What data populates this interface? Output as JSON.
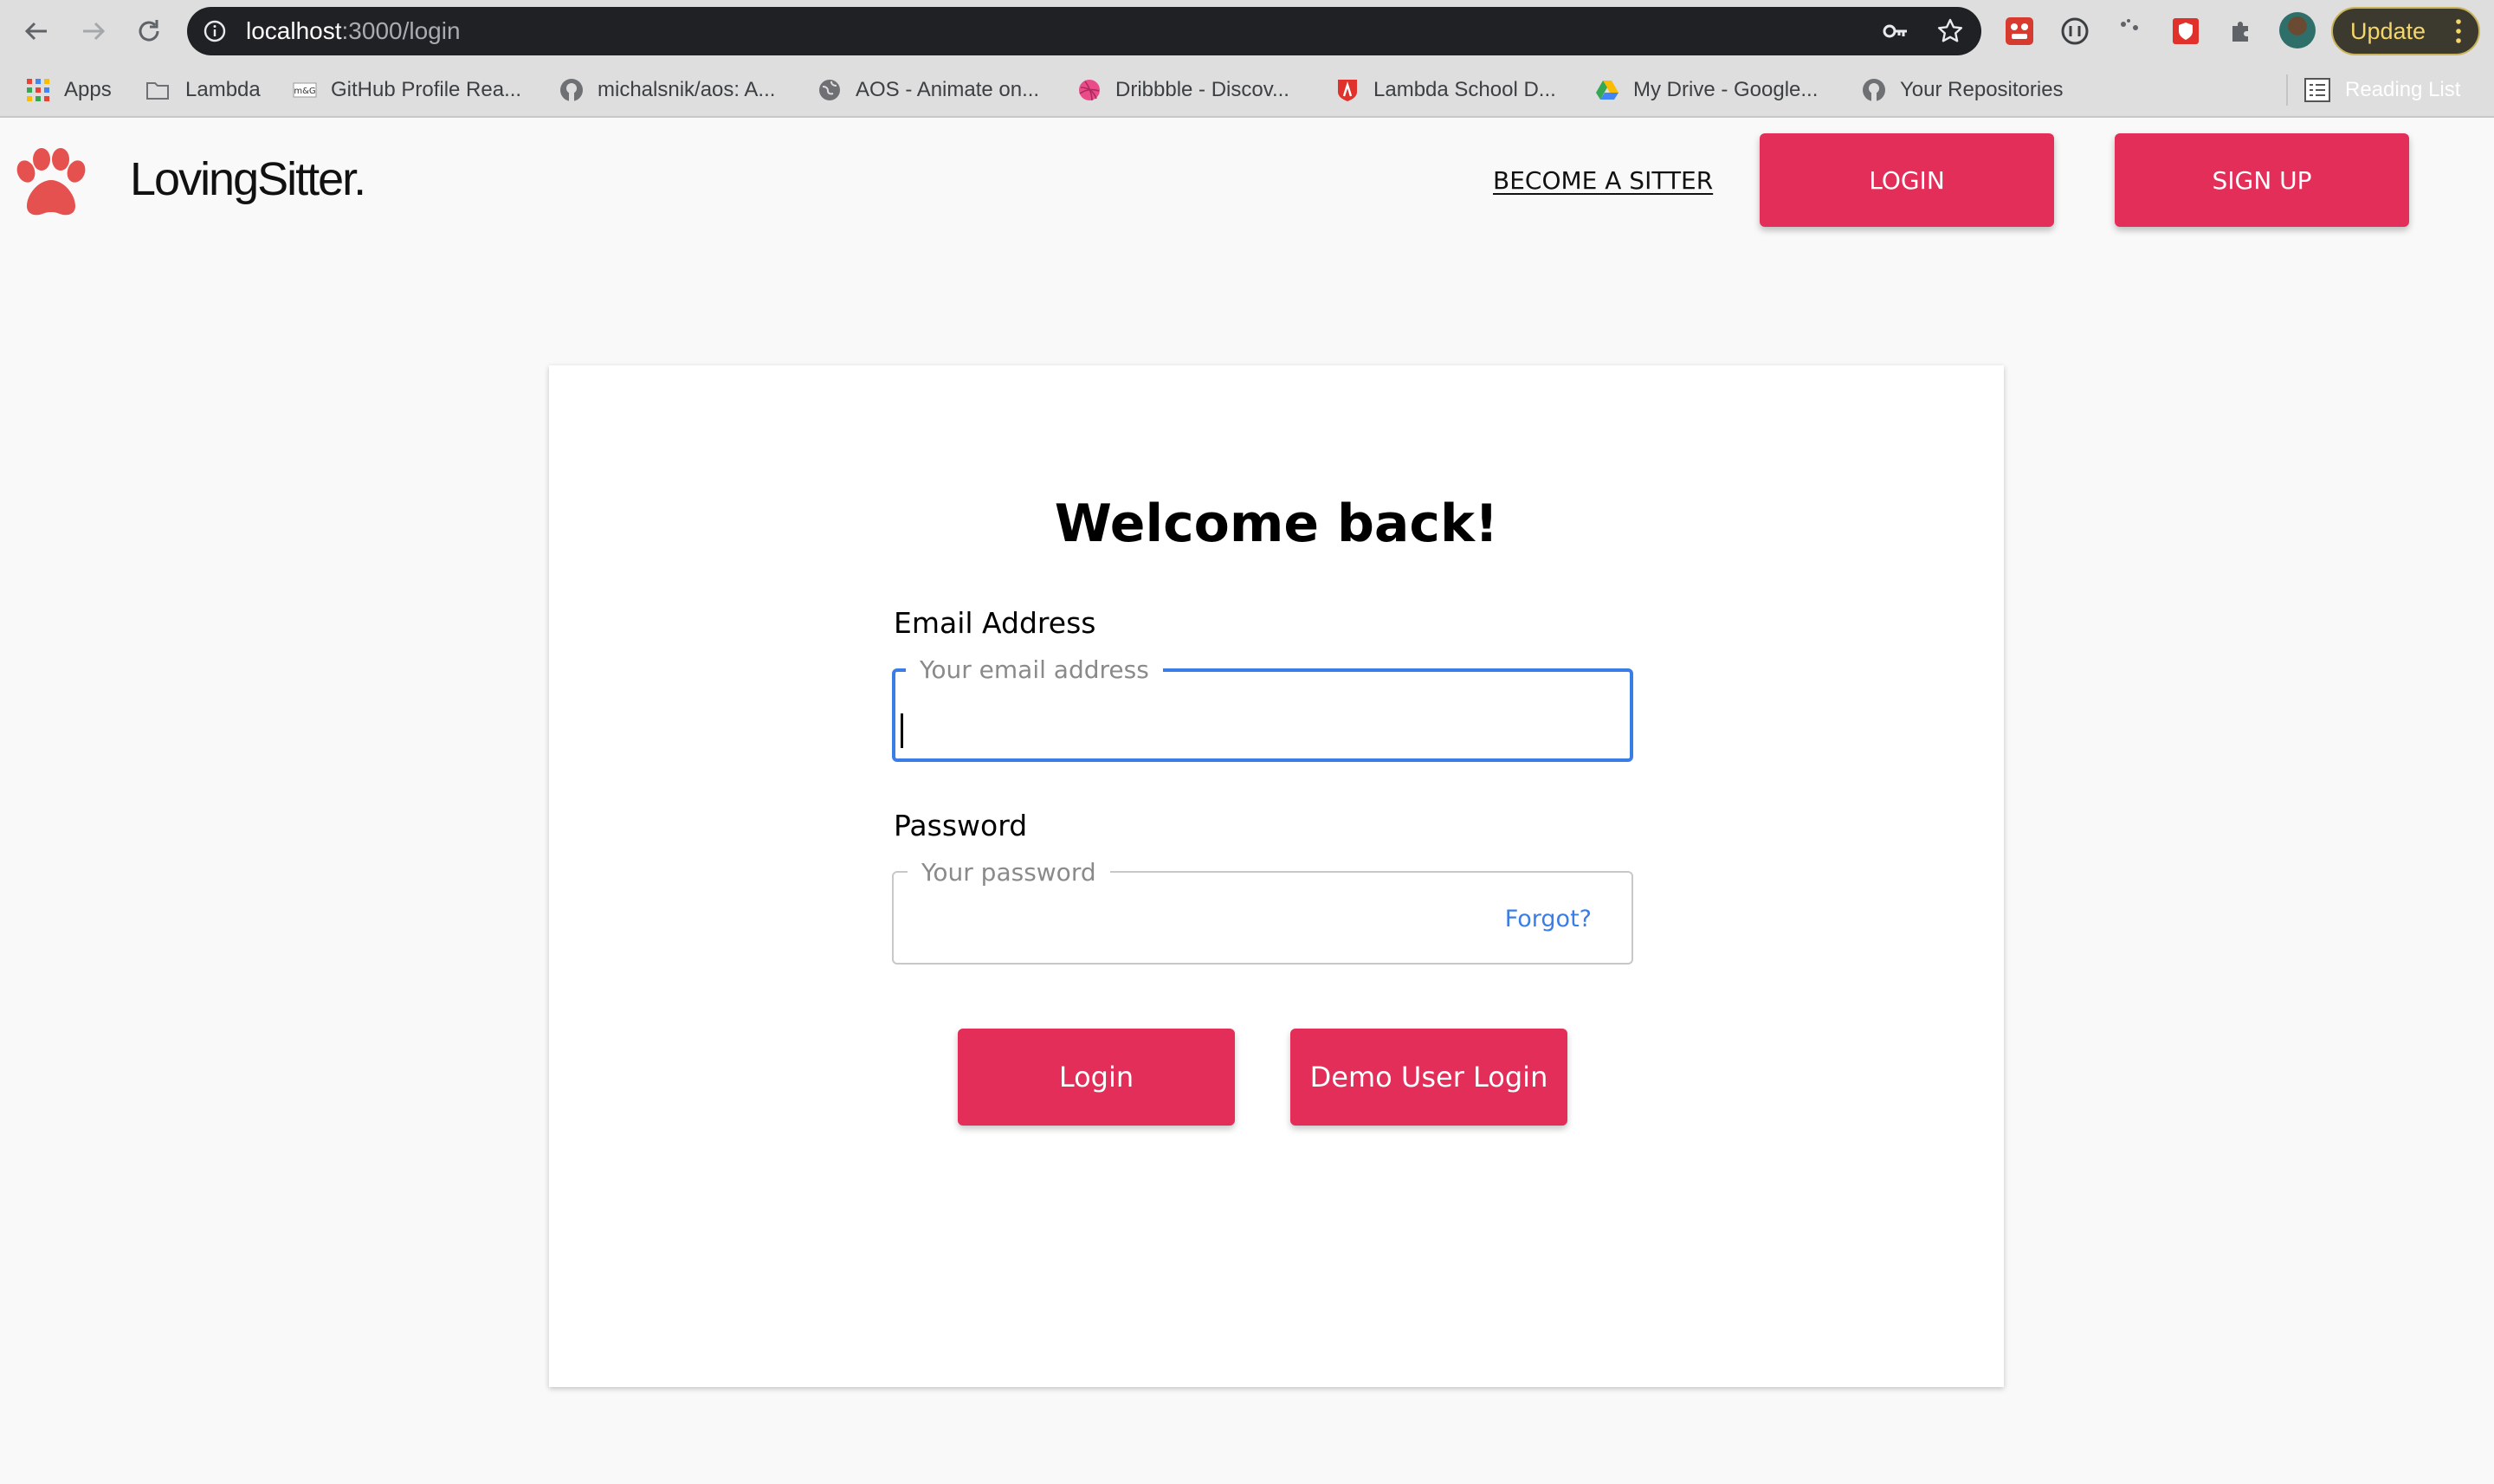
{
  "browser": {
    "url_host": "localhost",
    "url_path": ":3000/login",
    "update_label": "Update",
    "bookmarks": [
      {
        "label": "Apps"
      },
      {
        "label": "Lambda"
      },
      {
        "label": "GitHub Profile Rea..."
      },
      {
        "label": "michalsnik/aos: A..."
      },
      {
        "label": "AOS - Animate on..."
      },
      {
        "label": "Dribbble - Discov..."
      },
      {
        "label": "Lambda School D..."
      },
      {
        "label": "My Drive - Google..."
      },
      {
        "label": "Your Repositories"
      }
    ],
    "reading_list": "Reading List"
  },
  "header": {
    "brand": "LovingSitter.",
    "become_sitter": "BECOME A SITTER",
    "login": "LOGIN",
    "signup": "SIGN UP"
  },
  "form": {
    "title": "Welcome back!",
    "email_label": "Email Address",
    "email_placeholder": "Your email address",
    "password_label": "Password",
    "password_placeholder": "Your password",
    "forgot": "Forgot?",
    "login_button": "Login",
    "demo_button": "Demo User Login"
  },
  "colors": {
    "brand_accent": "#e22e58",
    "focus_blue": "#3b7de6",
    "paw": "#e5514e"
  }
}
